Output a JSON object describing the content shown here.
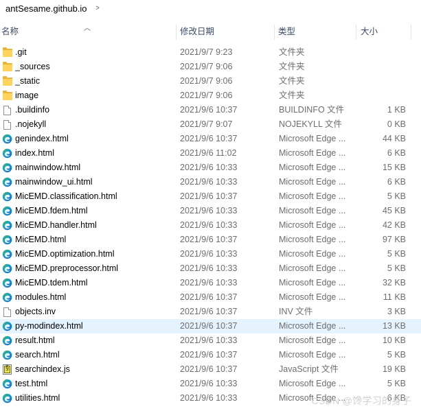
{
  "breadcrumb": {
    "path": "antSesame.github.io",
    "chevron": ">"
  },
  "columns": {
    "name": "名称",
    "date": "修改日期",
    "type": "类型",
    "size": "大小"
  },
  "colors": {
    "folder": "#ffd45c",
    "edge_blue": "#0c6ac4",
    "edge_green": "#36c26c",
    "selected_row": "#e5f3ff",
    "header_text": "#3a4a66"
  },
  "files": [
    {
      "name": ".git",
      "date": "2021/9/7 9:23",
      "type": "文件夹",
      "size": "",
      "icon": "folder-icon"
    },
    {
      "name": "_sources",
      "date": "2021/9/7 9:06",
      "type": "文件夹",
      "size": "",
      "icon": "folder-icon"
    },
    {
      "name": "_static",
      "date": "2021/9/7 9:06",
      "type": "文件夹",
      "size": "",
      "icon": "folder-icon"
    },
    {
      "name": "image",
      "date": "2021/9/7 9:06",
      "type": "文件夹",
      "size": "",
      "icon": "folder-icon"
    },
    {
      "name": ".buildinfo",
      "date": "2021/9/6 10:37",
      "type": "BUILDINFO 文件",
      "size": "1 KB",
      "icon": "file-icon"
    },
    {
      "name": ".nojekyll",
      "date": "2021/9/7 9:07",
      "type": "NOJEKYLL 文件",
      "size": "0 KB",
      "icon": "file-icon"
    },
    {
      "name": "genindex.html",
      "date": "2021/9/6 10:37",
      "type": "Microsoft Edge ...",
      "size": "44 KB",
      "icon": "edge-icon"
    },
    {
      "name": "index.html",
      "date": "2021/9/6 11:02",
      "type": "Microsoft Edge ...",
      "size": "6 KB",
      "icon": "edge-icon"
    },
    {
      "name": "mainwindow.html",
      "date": "2021/9/6 10:33",
      "type": "Microsoft Edge ...",
      "size": "15 KB",
      "icon": "edge-icon"
    },
    {
      "name": "mainwindow_ui.html",
      "date": "2021/9/6 10:33",
      "type": "Microsoft Edge ...",
      "size": "6 KB",
      "icon": "edge-icon"
    },
    {
      "name": "MicEMD.classification.html",
      "date": "2021/9/6 10:37",
      "type": "Microsoft Edge ...",
      "size": "5 KB",
      "icon": "edge-icon"
    },
    {
      "name": "MicEMD.fdem.html",
      "date": "2021/9/6 10:33",
      "type": "Microsoft Edge ...",
      "size": "45 KB",
      "icon": "edge-icon"
    },
    {
      "name": "MicEMD.handler.html",
      "date": "2021/9/6 10:33",
      "type": "Microsoft Edge ...",
      "size": "42 KB",
      "icon": "edge-icon"
    },
    {
      "name": "MicEMD.html",
      "date": "2021/9/6 10:37",
      "type": "Microsoft Edge ...",
      "size": "97 KB",
      "icon": "edge-icon"
    },
    {
      "name": "MicEMD.optimization.html",
      "date": "2021/9/6 10:33",
      "type": "Microsoft Edge ...",
      "size": "5 KB",
      "icon": "edge-icon"
    },
    {
      "name": "MicEMD.preprocessor.html",
      "date": "2021/9/6 10:33",
      "type": "Microsoft Edge ...",
      "size": "5 KB",
      "icon": "edge-icon"
    },
    {
      "name": "MicEMD.tdem.html",
      "date": "2021/9/6 10:33",
      "type": "Microsoft Edge ...",
      "size": "32 KB",
      "icon": "edge-icon"
    },
    {
      "name": "modules.html",
      "date": "2021/9/6 10:37",
      "type": "Microsoft Edge ...",
      "size": "11 KB",
      "icon": "edge-icon"
    },
    {
      "name": "objects.inv",
      "date": "2021/9/6 10:37",
      "type": "INV 文件",
      "size": "3 KB",
      "icon": "file-icon"
    },
    {
      "name": "py-modindex.html",
      "date": "2021/9/6 10:37",
      "type": "Microsoft Edge ...",
      "size": "13 KB",
      "icon": "edge-icon",
      "selected": true
    },
    {
      "name": "result.html",
      "date": "2021/9/6 10:33",
      "type": "Microsoft Edge ...",
      "size": "10 KB",
      "icon": "edge-icon"
    },
    {
      "name": "search.html",
      "date": "2021/9/6 10:37",
      "type": "Microsoft Edge ...",
      "size": "5 KB",
      "icon": "edge-icon"
    },
    {
      "name": "searchindex.js",
      "date": "2021/9/6 10:37",
      "type": "JavaScript 文件",
      "size": "19 KB",
      "icon": "js-icon"
    },
    {
      "name": "test.html",
      "date": "2021/9/6 10:33",
      "type": "Microsoft Edge ...",
      "size": "5 KB",
      "icon": "edge-icon"
    },
    {
      "name": "utilities.html",
      "date": "2021/9/6 10:33",
      "type": "Microsoft Edge ...",
      "size": "6 KB",
      "icon": "edge-icon"
    }
  ],
  "watermark": "CSDN @馋学习的身子"
}
